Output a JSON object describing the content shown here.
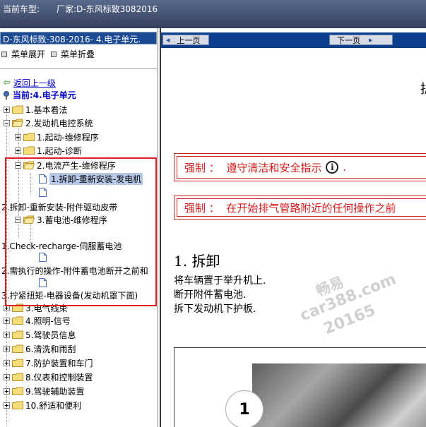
{
  "title_bar": {
    "current_vehicle_label": "当前车型:",
    "vehicle_value": "厂家:D-东风标致3082016"
  },
  "left_panel": {
    "model_bar": "D-东风标致-308-2016- 4.电子单元.",
    "menu_expand": "菜单展开",
    "menu_collapse": "菜单折叠",
    "back_link": "返回上一级",
    "current": "当前:4.电子单元",
    "tree": [
      {
        "label": "1.基本看法"
      },
      {
        "label": "2.发动机电控系统"
      },
      {
        "label": "1.起动-维修程序"
      },
      {
        "label": "1.起动-诊断"
      },
      {
        "label": "2.电流产生-维修程序"
      },
      {
        "label": "1.拆卸-重新安装-发电机"
      },
      {
        "label": "2.拆卸-重新安装-附件驱动皮带"
      },
      {
        "label": "3.蓄电池-维修程序"
      },
      {
        "label": "1.Check-recharge-伺服蓄电池"
      },
      {
        "label": "2.需执行的操作-附件蓄电池断开之前和"
      },
      {
        "label": "3.拧紧扭矩-电器设备(发动机罩下面)"
      },
      {
        "label": "3.电气线束"
      },
      {
        "label": "4.照明-信号"
      },
      {
        "label": "5.驾驶员信息"
      },
      {
        "label": "6.清洗和雨刮"
      },
      {
        "label": "7.防护装置和车门"
      },
      {
        "label": "8.仪表和控制装置"
      },
      {
        "label": "9.驾驶辅助装置"
      },
      {
        "label": "10.舒适和便利"
      }
    ]
  },
  "right_pane": {
    "prev_button": "上一页",
    "next_button": "下一页",
    "heading_partial": "拆",
    "warnings": [
      {
        "prefix": "强制 ：",
        "text": "遵守清洁和安全指示",
        "suffix": "."
      },
      {
        "prefix": "强制 ：",
        "text": "在开始排气管路附近的任何操作之前"
      }
    ],
    "section_title": "1.  拆卸",
    "steps": [
      "将车辆置于举升机上.",
      "断开附件蓄电池.",
      "拆下发动机下护板."
    ],
    "figure_callout": "1"
  },
  "watermark": {
    "line1": "畅易",
    "line2": "car388.com",
    "line3": "20165"
  },
  "colors": {
    "title_bar": "#3f4d6b",
    "model_bar": "#1c4a94",
    "nav_bar": "#0d3f8f",
    "warning_red": "#d61a1a",
    "highlight_red": "#e02020",
    "selected_bg": "#b6c8e6",
    "link_blue": "#0000cc"
  }
}
